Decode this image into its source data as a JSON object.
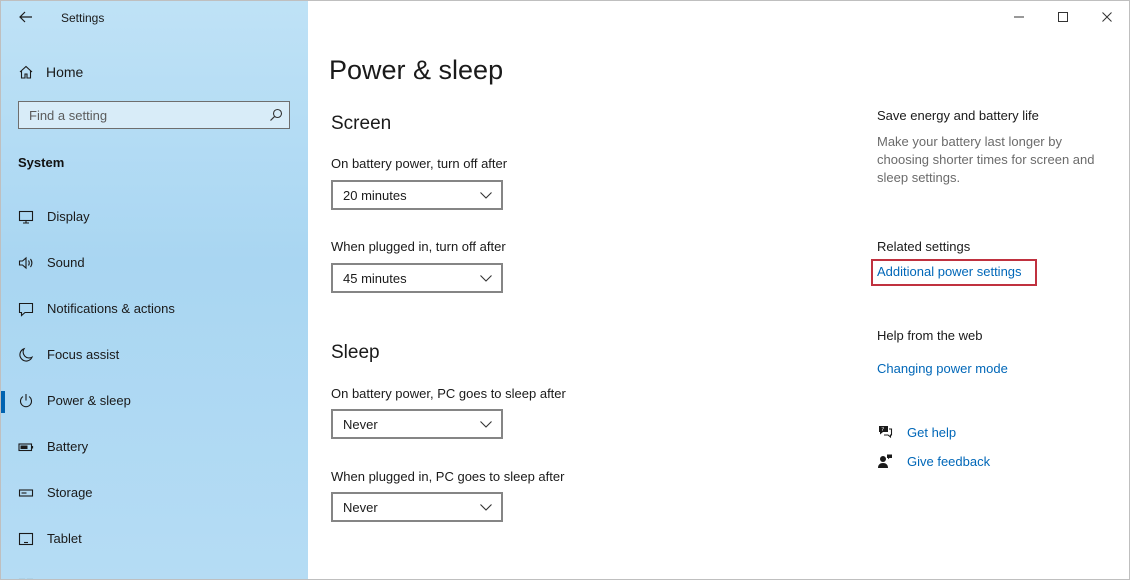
{
  "window": {
    "title": "Settings"
  },
  "sidebar": {
    "home_label": "Home",
    "search_placeholder": "Find a setting",
    "section_label": "System",
    "items": [
      {
        "label": "Display",
        "icon": "monitor-icon"
      },
      {
        "label": "Sound",
        "icon": "speaker-icon"
      },
      {
        "label": "Notifications & actions",
        "icon": "message-icon"
      },
      {
        "label": "Focus assist",
        "icon": "moon-icon"
      },
      {
        "label": "Power & sleep",
        "icon": "power-icon",
        "active": true
      },
      {
        "label": "Battery",
        "icon": "battery-icon"
      },
      {
        "label": "Storage",
        "icon": "storage-icon"
      },
      {
        "label": "Tablet",
        "icon": "tablet-icon"
      }
    ]
  },
  "main": {
    "title": "Power & sleep",
    "screen": {
      "heading": "Screen",
      "battery_label": "On battery power, turn off after",
      "battery_value": "20 minutes",
      "plugged_label": "When plugged in, turn off after",
      "plugged_value": "45 minutes"
    },
    "sleep": {
      "heading": "Sleep",
      "battery_label": "On battery power, PC goes to sleep after",
      "battery_value": "Never",
      "plugged_label": "When plugged in, PC goes to sleep after",
      "plugged_value": "Never"
    }
  },
  "right": {
    "save_title": "Save energy and battery life",
    "save_desc": "Make your battery last longer by choosing shorter times for screen and sleep settings.",
    "related_title": "Related settings",
    "related_link": "Additional power settings",
    "web_title": "Help from the web",
    "web_link": "Changing power mode",
    "get_help": "Get help",
    "give_feedback": "Give feedback"
  },
  "colors": {
    "accent": "#0063b1",
    "link": "#0067b8",
    "highlight": "#c0313f",
    "sidebar_bg": "#a9d6f2"
  }
}
